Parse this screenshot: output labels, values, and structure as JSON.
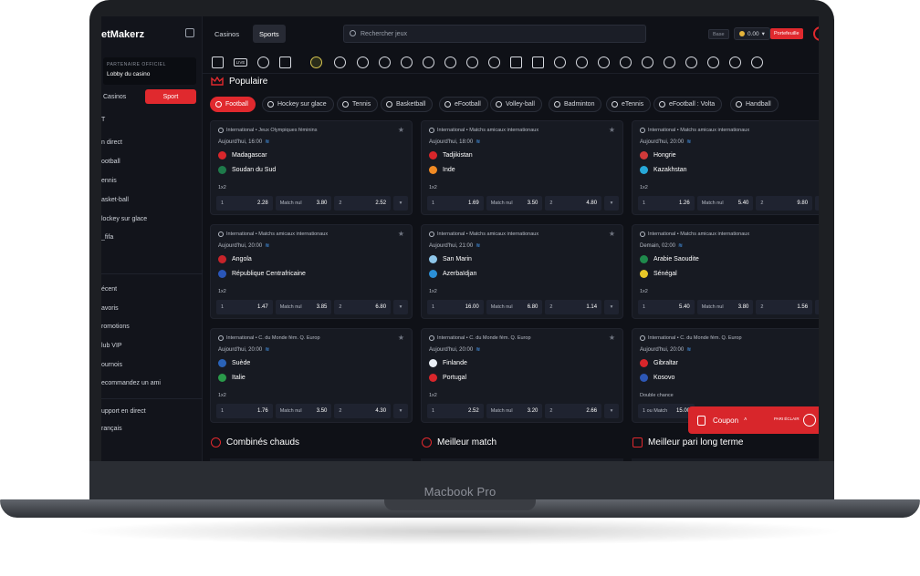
{
  "device": {
    "label": "Macbook Pro"
  },
  "sidebar": {
    "logo": "etMakerz",
    "partner_caption": "PARTENAIRE OFFICIEL",
    "partner_label": "Lobby du casino",
    "switch_casinos": "Casinos",
    "switch_sport": "Sport",
    "section_letter": "T",
    "items": [
      "n direct",
      "ootball",
      "ennis",
      "asket-ball",
      "lockey sur glace",
      "_fifa"
    ],
    "items2": [
      "écent",
      "avoris",
      "romotions",
      "lub VIP",
      "ournois",
      "ecommandez un ami"
    ],
    "items3": [
      "upport en direct",
      "rançais"
    ]
  },
  "topbar": {
    "tab_casinos": "Casinos",
    "tab_sports": "Sports",
    "search_placeholder": "Rechercher jeux",
    "base_label": "Base",
    "balance": "0.00",
    "wallet_label": "Portefeuille"
  },
  "sport_icons": [
    "home-icon",
    "live-icon",
    "star-icon",
    "betslip-icon",
    "selected-sport-icon",
    "soccer-icon",
    "basketball-icon",
    "tennis-icon",
    "badminton-icon",
    "hockey-icon",
    "volleyball-icon",
    "tabletennis-icon",
    "chess-icon",
    "flag-icon",
    "esports-icon",
    "golf-icon",
    "baseball-icon",
    "rugby-icon",
    "efootball-icon",
    "handball-icon",
    "darts-icon",
    "boxing-icon",
    "more-icon"
  ],
  "sport_live_text": "LIVE",
  "populaire": {
    "title": "Populaire"
  },
  "chips": [
    "Football",
    "Hockey sur glace",
    "Tennis",
    "Basketball",
    "eFootball",
    "Volley-ball",
    "Badminton",
    "eTennis",
    "eFootball : Volta",
    "Handball"
  ],
  "cards": [
    {
      "league": "International  •  Jeux Olympiques féminins",
      "time": "Aujourd'hui, 16:00",
      "team1": "Madagascar",
      "team2": "Soudan du Sud",
      "market": "1x2",
      "l1": "1",
      "o1": "2.28",
      "lx": "Match nul",
      "ox": "3.80",
      "l2": "2",
      "o2": "2.52",
      "c1": "#d8262b",
      "c2": "#1e7a4a"
    },
    {
      "league": "International  •  Matchs amicaux internationaux",
      "time": "Aujourd'hui, 18:00",
      "team1": "Tadjikistan",
      "team2": "Inde",
      "market": "1x2",
      "l1": "1",
      "o1": "1.69",
      "lx": "Match nul",
      "ox": "3.50",
      "l2": "2",
      "o2": "4.80",
      "c1": "#d8262b",
      "c2": "#f08a24"
    },
    {
      "league": "International  •  Matchs amicaux internationaux",
      "time": "Aujourd'hui, 20:00",
      "team1": "Hongrie",
      "team2": "Kazakhstan",
      "market": "1x2",
      "l1": "1",
      "o1": "1.26",
      "lx": "Match nul",
      "ox": "5.40",
      "l2": "2",
      "o2": "9.80",
      "c1": "#cf3a3a",
      "c2": "#27a8d8"
    },
    {
      "league": "International  •  Matchs amicaux internationaux",
      "time": "Aujourd'hui, 20:00",
      "team1": "Angola",
      "team2": "République Centrafricaine",
      "market": "1x2",
      "l1": "1",
      "o1": "1.47",
      "lx": "Match nul",
      "ox": "3.85",
      "l2": "2",
      "o2": "6.80",
      "c1": "#c8242a",
      "c2": "#2a56b8"
    },
    {
      "league": "International  •  Matchs amicaux internationaux",
      "time": "Aujourd'hui, 21:00",
      "team1": "San Marin",
      "team2": "Azerbaïdjan",
      "market": "1x2",
      "l1": "1",
      "o1": "16.00",
      "lx": "Match nul",
      "ox": "6.80",
      "l2": "2",
      "o2": "1.14",
      "c1": "#8ec6ea",
      "c2": "#2b8fd6"
    },
    {
      "league": "International  •  Matchs amicaux internationaux",
      "time": "Demain, 02:00",
      "team1": "Arabie Saoudite",
      "team2": "Sénégal",
      "market": "1x2",
      "l1": "1",
      "o1": "5.40",
      "lx": "Match nul",
      "ox": "3.80",
      "l2": "2",
      "o2": "1.56",
      "c1": "#1f8a4c",
      "c2": "#e7c728"
    },
    {
      "league": "International  •  C. du Monde fém. Q. Europ",
      "time": "Aujourd'hui, 20:00",
      "team1": "Suède",
      "team2": "Italie",
      "market": "1x2",
      "l1": "1",
      "o1": "1.76",
      "lx": "Match nul",
      "ox": "3.50",
      "l2": "2",
      "o2": "4.30",
      "c1": "#2a63b8",
      "c2": "#2a9a4a"
    },
    {
      "league": "International  •  C. du Monde fém. Q. Europ",
      "time": "Aujourd'hui, 20:00",
      "team1": "Finlande",
      "team2": "Portugal",
      "market": "1x2",
      "l1": "1",
      "o1": "2.52",
      "lx": "Match nul",
      "ox": "3.20",
      "l2": "2",
      "o2": "2.66",
      "c1": "#e9eef5",
      "c2": "#d8262b"
    },
    {
      "league": "International  •  C. du Monde fém. Q. Europ",
      "time": "Aujourd'hui, 20:00",
      "team1": "Gibraltar",
      "team2": "Kosovo",
      "market": "Double chance",
      "l1": "1 ou Match",
      "o1": "15.00",
      "lx": "",
      "ox": "",
      "l2": "",
      "o2": "",
      "c1": "#d8262b",
      "c2": "#2d57b5"
    }
  ],
  "coupon": {
    "label": "Coupon",
    "caret": "˄",
    "express": "PARI ÉCLAIR"
  },
  "bottom": {
    "t1": "Combinés chauds",
    "t2": "Meilleur match",
    "t3": "Meilleur pari long terme"
  },
  "colors": {
    "accent": "#e0292e",
    "bg": "#0f1117",
    "card": "#171a22"
  }
}
